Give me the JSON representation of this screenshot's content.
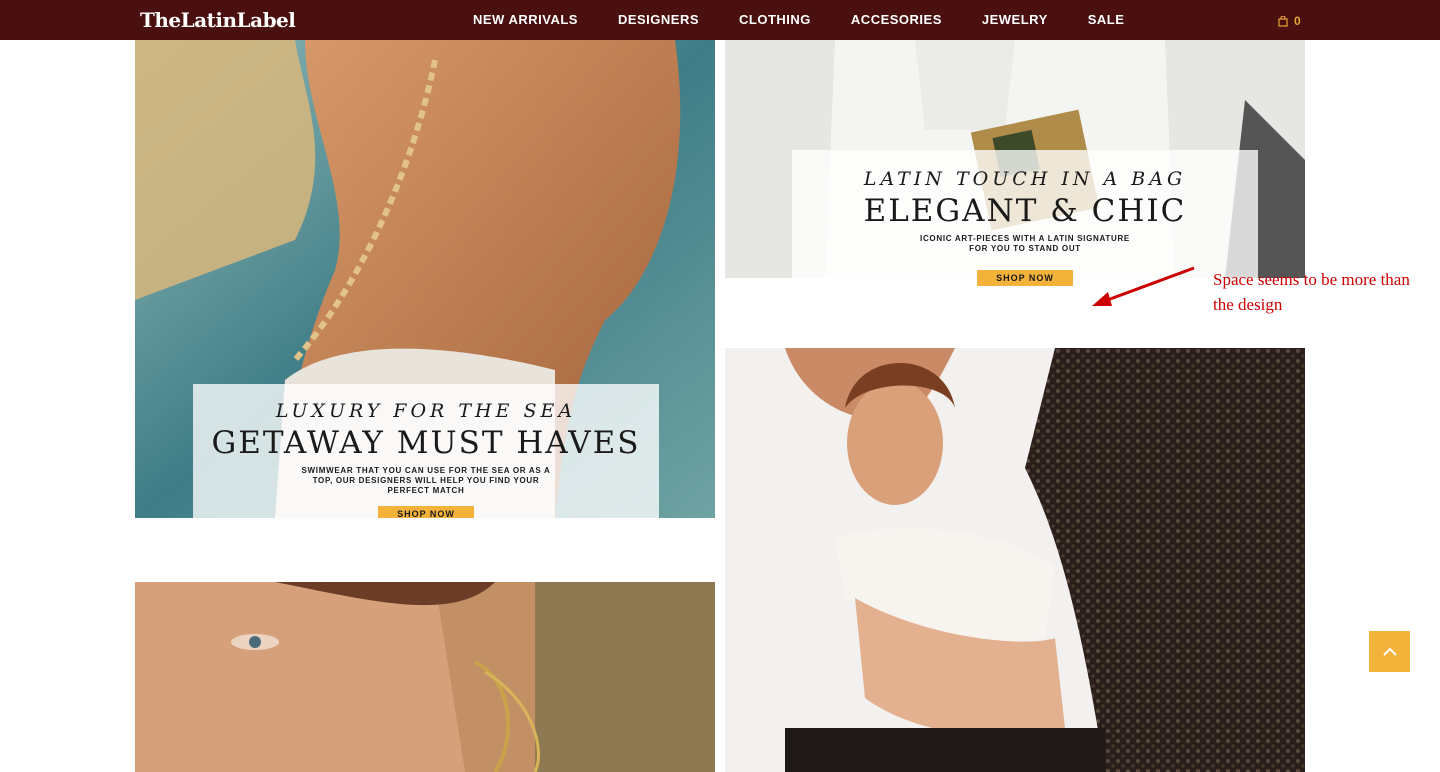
{
  "header": {
    "logo_text": "TheLatinLabel",
    "nav": [
      "NEW ARRIVALS",
      "DESIGNERS",
      "CLOTHING",
      "ACCESORIES",
      "JEWELRY",
      "SALE"
    ],
    "cart_icon": "bag-icon",
    "cart_count": "0"
  },
  "promos": {
    "sea": {
      "kicker": "LUXURY FOR THE SEA",
      "headline": "GETAWAY MUST HAVES",
      "sub": "SWIMWEAR THAT YOU CAN USE FOR THE SEA OR AS A TOP, OUR DESIGNERS WILL HELP YOU FIND YOUR PERFECT MATCH",
      "cta": "SHOP NOW"
    },
    "bag": {
      "kicker": "LATIN TOUCH IN A BAG",
      "headline": "ELEGANT & CHIC",
      "sub": "ICONIC ART-PIECES WITH A LATIN SIGNATURE FOR YOU TO STAND OUT",
      "cta": "SHOP NOW"
    }
  },
  "annotation": {
    "text": "Space seems to be more than the design",
    "color": "#cc0000"
  },
  "back_to_top_icon": "chevron-up-icon",
  "colors": {
    "header_bg": "#4a0f0f",
    "accent": "#f3b23a"
  }
}
